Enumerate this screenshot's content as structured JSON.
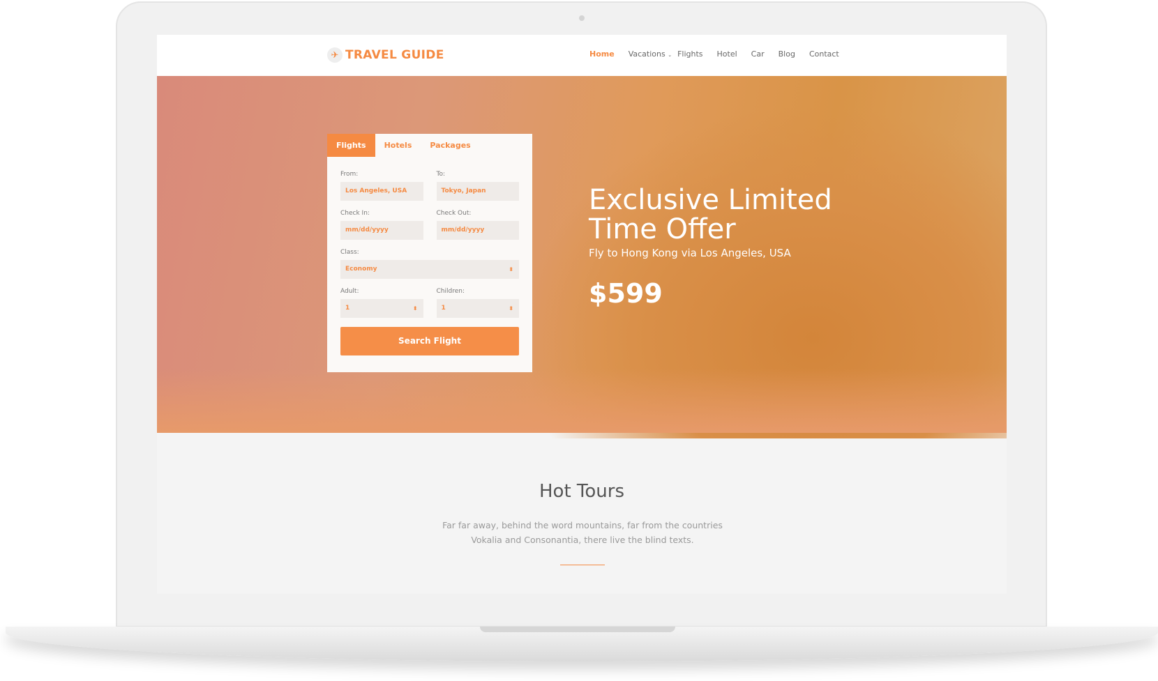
{
  "brand": {
    "name": "TRAVEL GUIDE",
    "icon": "airplane-icon",
    "accent": "#f58a42"
  },
  "nav": [
    "Home",
    "Vacations",
    "Flights",
    "Hotel",
    "Car",
    "Blog",
    "Contact"
  ],
  "booking": {
    "tabs": [
      "Flights",
      "Hotels",
      "Packages"
    ],
    "from_label": "From:",
    "from_value": "Los Angeles, USA",
    "to_label": "To:",
    "to_value": "Tokyo, Japan",
    "checkin_label": "Check In:",
    "checkin_placeholder": "mm/dd/yyyy",
    "checkout_label": "Check Out:",
    "checkout_placeholder": "mm/dd/yyyy",
    "class_label": "Class:",
    "class_value": "Economy",
    "adult_label": "Adult:",
    "adult_value": "1",
    "children_label": "Children:",
    "children_value": "1",
    "submit": "Search Flight"
  },
  "hero": {
    "title": "Exclusive Limited Time Offer",
    "subtitle": "Fly to Hong Kong via Los Angeles, USA",
    "price": "$599"
  },
  "tours": {
    "title": "Hot Tours",
    "text": "Far far away, behind the word mountains, far from the countries Vokalia and Consonantia, there live the blind texts."
  }
}
